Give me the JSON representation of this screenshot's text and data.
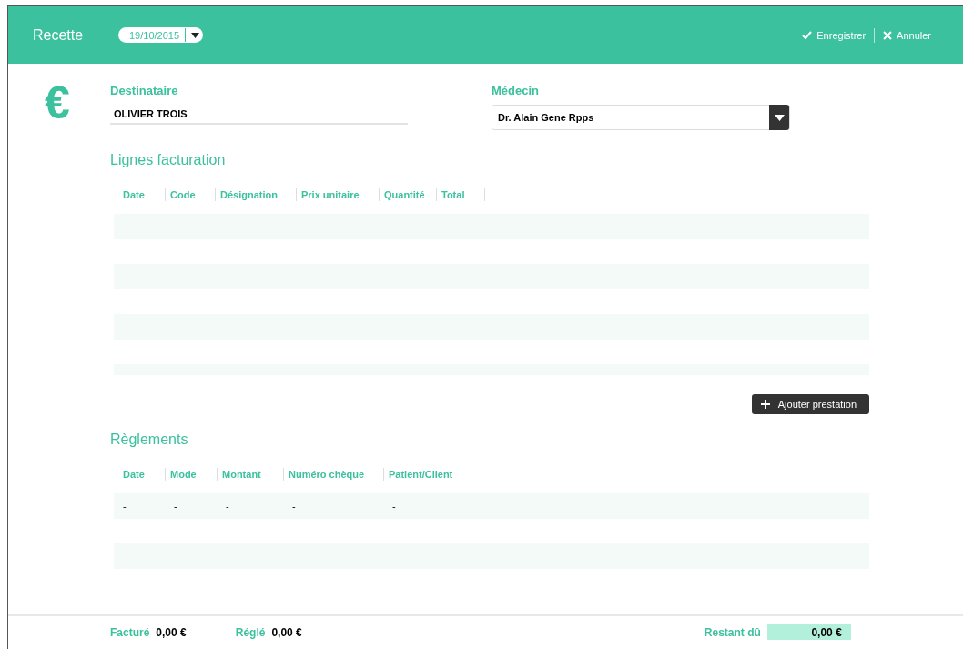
{
  "header": {
    "title": "Recette",
    "date": "19/10/2015",
    "actions": [
      {
        "kind": "save",
        "label": "Enregistrer"
      },
      {
        "kind": "cancel",
        "label": "Annuler"
      }
    ]
  },
  "currency_symbol": "€",
  "recipient": {
    "label": "Destinataire",
    "value": "OLIVIER TROIS"
  },
  "doctor": {
    "label": "Médecin",
    "value": "Dr. Alain Gene Rpps"
  },
  "billing": {
    "title": "Lignes facturation",
    "columns": [
      "Date",
      "Code",
      "Désignation",
      "Prix unitaire",
      "Quantité",
      "Total"
    ],
    "rows": [
      {
        "kind": "empty"
      },
      {
        "kind": "empty"
      },
      {
        "kind": "empty"
      },
      {
        "kind": "empty"
      },
      {
        "kind": "empty"
      },
      {
        "kind": "empty"
      },
      {
        "kind": "empty"
      }
    ],
    "add_button": "Ajouter prestation"
  },
  "payments": {
    "title": "Règlements",
    "columns": [
      "Date",
      "Mode",
      "Montant",
      "Numéro chèque",
      "Patient/Client"
    ],
    "rows": [
      {
        "kind": "filled",
        "cells": [
          "-",
          "-",
          "-",
          "-",
          "-"
        ]
      },
      {
        "kind": "empty"
      },
      {
        "kind": "empty"
      }
    ]
  },
  "footer": {
    "billed": {
      "label": "Facturé",
      "value": "0,00 €"
    },
    "paid": {
      "label": "Réglé",
      "value": "0,00 €"
    },
    "remaining": {
      "label": "Restant dû",
      "value": "0,00 €"
    }
  }
}
